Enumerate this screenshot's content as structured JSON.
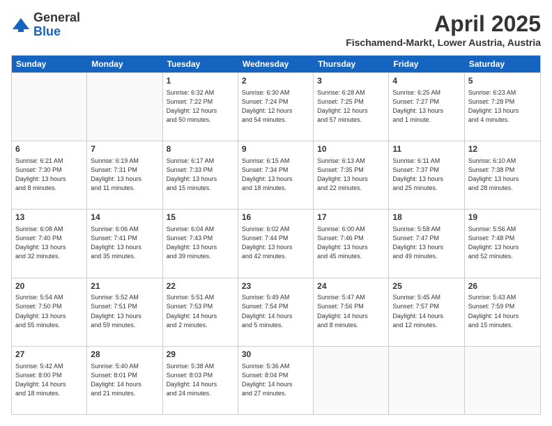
{
  "header": {
    "logo_general": "General",
    "logo_blue": "Blue",
    "month": "April 2025",
    "location": "Fischamend-Markt, Lower Austria, Austria"
  },
  "weekdays": [
    "Sunday",
    "Monday",
    "Tuesday",
    "Wednesday",
    "Thursday",
    "Friday",
    "Saturday"
  ],
  "rows": [
    [
      {
        "day": "",
        "info": ""
      },
      {
        "day": "",
        "info": ""
      },
      {
        "day": "1",
        "info": "Sunrise: 6:32 AM\nSunset: 7:22 PM\nDaylight: 12 hours\nand 50 minutes."
      },
      {
        "day": "2",
        "info": "Sunrise: 6:30 AM\nSunset: 7:24 PM\nDaylight: 12 hours\nand 54 minutes."
      },
      {
        "day": "3",
        "info": "Sunrise: 6:28 AM\nSunset: 7:25 PM\nDaylight: 12 hours\nand 57 minutes."
      },
      {
        "day": "4",
        "info": "Sunrise: 6:25 AM\nSunset: 7:27 PM\nDaylight: 13 hours\nand 1 minute."
      },
      {
        "day": "5",
        "info": "Sunrise: 6:23 AM\nSunset: 7:28 PM\nDaylight: 13 hours\nand 4 minutes."
      }
    ],
    [
      {
        "day": "6",
        "info": "Sunrise: 6:21 AM\nSunset: 7:30 PM\nDaylight: 13 hours\nand 8 minutes."
      },
      {
        "day": "7",
        "info": "Sunrise: 6:19 AM\nSunset: 7:31 PM\nDaylight: 13 hours\nand 11 minutes."
      },
      {
        "day": "8",
        "info": "Sunrise: 6:17 AM\nSunset: 7:33 PM\nDaylight: 13 hours\nand 15 minutes."
      },
      {
        "day": "9",
        "info": "Sunrise: 6:15 AM\nSunset: 7:34 PM\nDaylight: 13 hours\nand 18 minutes."
      },
      {
        "day": "10",
        "info": "Sunrise: 6:13 AM\nSunset: 7:35 PM\nDaylight: 13 hours\nand 22 minutes."
      },
      {
        "day": "11",
        "info": "Sunrise: 6:11 AM\nSunset: 7:37 PM\nDaylight: 13 hours\nand 25 minutes."
      },
      {
        "day": "12",
        "info": "Sunrise: 6:10 AM\nSunset: 7:38 PM\nDaylight: 13 hours\nand 28 minutes."
      }
    ],
    [
      {
        "day": "13",
        "info": "Sunrise: 6:08 AM\nSunset: 7:40 PM\nDaylight: 13 hours\nand 32 minutes."
      },
      {
        "day": "14",
        "info": "Sunrise: 6:06 AM\nSunset: 7:41 PM\nDaylight: 13 hours\nand 35 minutes."
      },
      {
        "day": "15",
        "info": "Sunrise: 6:04 AM\nSunset: 7:43 PM\nDaylight: 13 hours\nand 39 minutes."
      },
      {
        "day": "16",
        "info": "Sunrise: 6:02 AM\nSunset: 7:44 PM\nDaylight: 13 hours\nand 42 minutes."
      },
      {
        "day": "17",
        "info": "Sunrise: 6:00 AM\nSunset: 7:46 PM\nDaylight: 13 hours\nand 45 minutes."
      },
      {
        "day": "18",
        "info": "Sunrise: 5:58 AM\nSunset: 7:47 PM\nDaylight: 13 hours\nand 49 minutes."
      },
      {
        "day": "19",
        "info": "Sunrise: 5:56 AM\nSunset: 7:48 PM\nDaylight: 13 hours\nand 52 minutes."
      }
    ],
    [
      {
        "day": "20",
        "info": "Sunrise: 5:54 AM\nSunset: 7:50 PM\nDaylight: 13 hours\nand 55 minutes."
      },
      {
        "day": "21",
        "info": "Sunrise: 5:52 AM\nSunset: 7:51 PM\nDaylight: 13 hours\nand 59 minutes."
      },
      {
        "day": "22",
        "info": "Sunrise: 5:51 AM\nSunset: 7:53 PM\nDaylight: 14 hours\nand 2 minutes."
      },
      {
        "day": "23",
        "info": "Sunrise: 5:49 AM\nSunset: 7:54 PM\nDaylight: 14 hours\nand 5 minutes."
      },
      {
        "day": "24",
        "info": "Sunrise: 5:47 AM\nSunset: 7:56 PM\nDaylight: 14 hours\nand 8 minutes."
      },
      {
        "day": "25",
        "info": "Sunrise: 5:45 AM\nSunset: 7:57 PM\nDaylight: 14 hours\nand 12 minutes."
      },
      {
        "day": "26",
        "info": "Sunrise: 5:43 AM\nSunset: 7:59 PM\nDaylight: 14 hours\nand 15 minutes."
      }
    ],
    [
      {
        "day": "27",
        "info": "Sunrise: 5:42 AM\nSunset: 8:00 PM\nDaylight: 14 hours\nand 18 minutes."
      },
      {
        "day": "28",
        "info": "Sunrise: 5:40 AM\nSunset: 8:01 PM\nDaylight: 14 hours\nand 21 minutes."
      },
      {
        "day": "29",
        "info": "Sunrise: 5:38 AM\nSunset: 8:03 PM\nDaylight: 14 hours\nand 24 minutes."
      },
      {
        "day": "30",
        "info": "Sunrise: 5:36 AM\nSunset: 8:04 PM\nDaylight: 14 hours\nand 27 minutes."
      },
      {
        "day": "",
        "info": ""
      },
      {
        "day": "",
        "info": ""
      },
      {
        "day": "",
        "info": ""
      }
    ]
  ]
}
